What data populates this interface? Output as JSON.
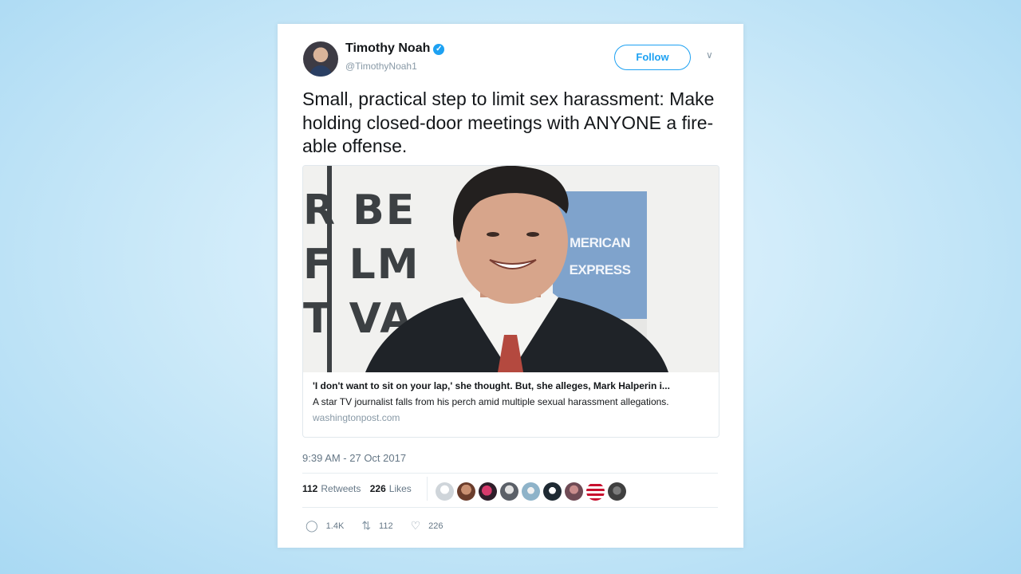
{
  "tweet": {
    "author_name": "Timothy Noah",
    "author_handle": "@TimothyNoah1",
    "follow_label": "Follow",
    "text": "Small, practical step to limit sex harassment: Make holding closed-door meetings with ANYONE a fire-able offense.",
    "link_card": {
      "title": "'I don't want to sit on your lap,' she thought. But, she alleges, Mark Halperin i...",
      "description": "A star TV journalist falls from his perch amid multiple sexual harassment allegations.",
      "domain": "washingtonpost.com",
      "image_backdrop_letters": [
        "R BE",
        "F LM",
        "T VA"
      ],
      "image_logo_text": [
        "MERICAN",
        "EXPRESS"
      ]
    },
    "timestamp": "9:39 AM - 27 Oct 2017",
    "stats": {
      "retweets_count": "112",
      "retweets_label": "Retweets",
      "likes_count": "226",
      "likes_label": "Likes"
    },
    "actions": {
      "replies": "1.4K",
      "retweets": "112",
      "likes": "226"
    }
  },
  "colors": {
    "accent": "#1da1f2",
    "text": "#14171a",
    "muted": "#657786"
  },
  "icons": {
    "verified": "verified-badge-icon",
    "chevron": "chevron-down-icon",
    "reply": "reply-icon",
    "retweet": "retweet-icon",
    "like": "heart-icon"
  }
}
